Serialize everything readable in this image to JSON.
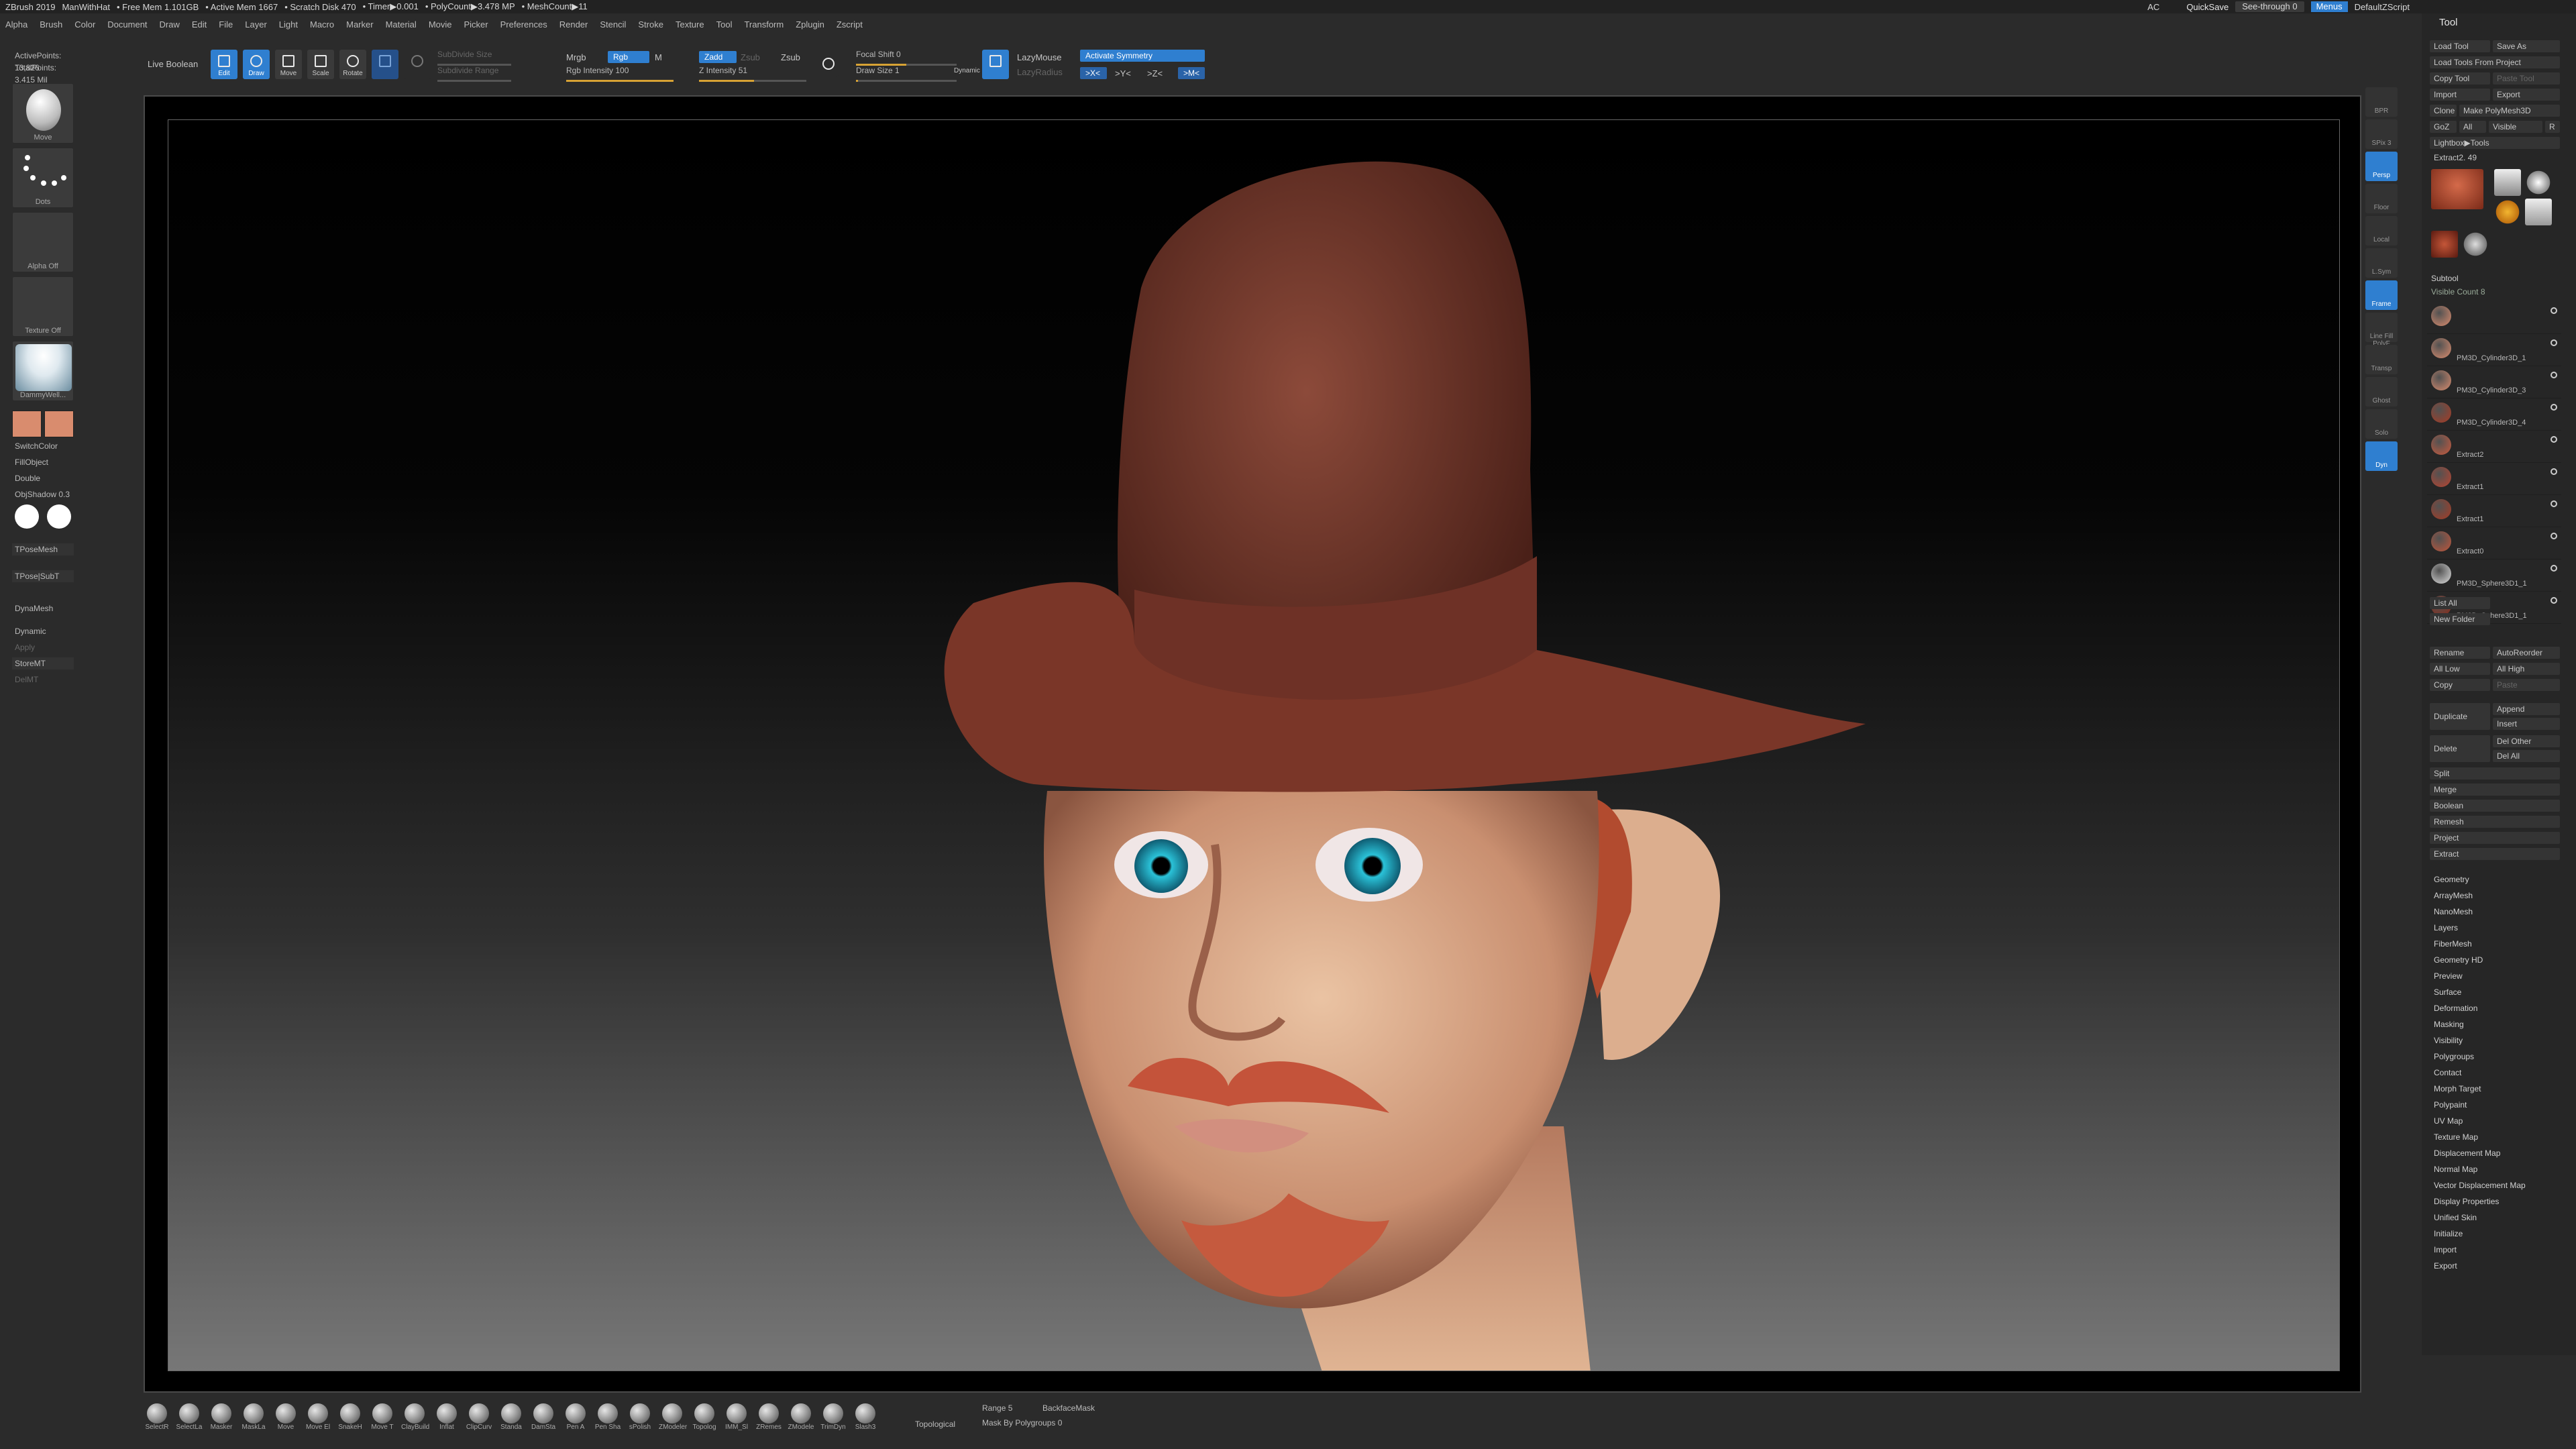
{
  "titlebar": {
    "app": "ZBrush 2019",
    "doc": "ManWithHat",
    "freemem": "• Free Mem 1.101GB",
    "activemem": "• Active Mem 1667",
    "scratch": "• Scratch Disk 470",
    "timer": "• Timer▶0.001",
    "polycount": "• PolyCount▶3.478 MP",
    "meshcount": "• MeshCount▶11",
    "ac": "AC",
    "quicksave": "QuickSave",
    "seethrough": "See-through  0",
    "menus": "Menus",
    "script": "DefaultZScript"
  },
  "menu": [
    "Alpha",
    "Brush",
    "Color",
    "Document",
    "Draw",
    "Edit",
    "File",
    "Layer",
    "Light",
    "Macro",
    "Marker",
    "Material",
    "Movie",
    "Picker",
    "Preferences",
    "Render",
    "Stencil",
    "Stroke",
    "Texture",
    "Tool",
    "Transform",
    "Zplugin",
    "Zscript"
  ],
  "top": {
    "livebool": "Live Boolean",
    "edit": "Edit",
    "draw": "Draw",
    "move": "Move",
    "scale": "Scale",
    "rotate": "Rotate",
    "subdiv": "SubDivide Size",
    "subdivrange": "Subdivide Range",
    "mrgb": "Mrgb",
    "rgb": "Rgb",
    "m": "M",
    "rgbint": "Rgb Intensity 100",
    "zadd": "Zadd",
    "zsub": "Zsub",
    "zsub2": "Zsub",
    "zint": "Z Intensity 51",
    "focal": "Focal Shift 0",
    "drawsize": "Draw Size 1",
    "dynamic": "Dynamic",
    "lazymouse": "LazyMouse",
    "lazyradius": "LazyRadius",
    "activatesym": "Activate Symmetry",
    "symx": ">X<",
    "symy": ">Y<",
    "symz": ">Z<",
    "symm": ">M<",
    "rgb_fill": 1.0,
    "zint_fill": 0.51,
    "focal_fill": 0.5,
    "drawsize_fill": 0.02
  },
  "left": {
    "activepoints": "ActivePoints: 13,826",
    "totalpoints": "TotalPoints: 3.415 Mil",
    "brush": "Move",
    "stroke": "Dots",
    "alpha": "Alpha Off",
    "texture": "Texture Off",
    "material": "DammyWell...",
    "switchcolor": "SwitchColor",
    "fillobject": "FillObject",
    "double": "Double",
    "objshadow": "ObjShadow 0.3",
    "tposemesh": "TPoseMesh",
    "tposesubt": "TPose|SubT",
    "dynamesh": "DynaMesh",
    "dynamic": "Dynamic",
    "apply": "Apply",
    "stalemt": "StoreMT",
    "delmt": "DelMT",
    "colors": [
      "#d98c6e",
      "#d98c6e"
    ]
  },
  "rightshelf": [
    "BPR",
    "SPix 3",
    "Persp",
    "Floor",
    "Local",
    "L.Sym",
    "Frame",
    "Line Fill PolyF",
    "Transp",
    "Ghost",
    "Solo",
    "Dyn"
  ],
  "tool": {
    "title": "Tool",
    "loadtool": "Load Tool",
    "saveas": "Save As",
    "loadfromproject": "Load Tools From Project",
    "copytool": "Copy Tool",
    "pastetool": "Paste Tool",
    "import": "Import",
    "export": "Export",
    "clone": "Clone",
    "makepoly": "Make PolyMesh3D",
    "goz": "GoZ",
    "all": "All",
    "visible": "Visible",
    "r": "R",
    "lightbox": "Lightbox▶Tools",
    "extract2": "Extract2. 49",
    "subtool": "Subtool",
    "visiblecount": "Visible Count 8",
    "subtools": [
      "",
      "PM3D_Cylinder3D_1",
      "PM3D_Cylinder3D_3",
      "PM3D_Cylinder3D_4",
      "Extract2",
      "Extract1",
      "Extract1",
      "Extract0",
      "PM3D_Sphere3D1_1",
      "PM3D_Sphere3D1_1"
    ],
    "listall": "List All",
    "newfolder": "New Folder",
    "rename": "Rename",
    "autoreorder": "AutoReorder",
    "alllow": "All Low",
    "allhigh": "All High",
    "copy": "Copy",
    "paste": "Paste",
    "duplicate": "Duplicate",
    "append": "Append",
    "insert": "Insert",
    "delete": "Delete",
    "delother": "Del Other",
    "delall": "Del All",
    "split": "Split",
    "merge": "Merge",
    "boolean": "Boolean",
    "remesh": "Remesh",
    "project": "Project",
    "extract": "Extract",
    "sections": [
      "Geometry",
      "ArrayMesh",
      "NanoMesh",
      "Layers",
      "FiberMesh",
      "Geometry HD",
      "Preview",
      "Surface",
      "Deformation",
      "Masking",
      "Visibility",
      "Polygroups",
      "Contact",
      "Morph Target",
      "Polypaint",
      "UV Map",
      "Texture Map",
      "Displacement Map",
      "Normal Map",
      "Vector Displacement Map",
      "Display Properties",
      "Unified Skin",
      "Initialize",
      "Import",
      "Export"
    ]
  },
  "bottom": {
    "brushes": [
      "SelectR",
      "SelectLa",
      "Masker",
      "MaskLa",
      "Move",
      "Move El",
      "SnakeH",
      "Move T",
      "ClayBuild",
      "Inflat",
      "ClipCurv",
      "Standa",
      "DamSta",
      "Pen A",
      "Pen Sha",
      "sPolish",
      "ZModeler",
      "Topolog",
      "IMM_Sl",
      "ZRemes",
      "ZModele",
      "TrimDyn",
      "Slash3"
    ],
    "topological": "Topological",
    "range": "Range 5",
    "backface": "BackfaceMask",
    "maskbypoly": "Mask By Polygroups 0"
  }
}
